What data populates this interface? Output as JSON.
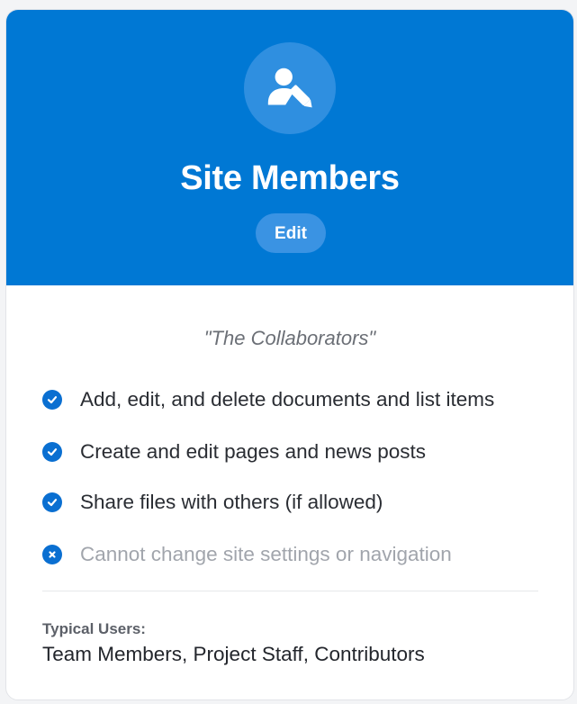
{
  "card": {
    "title": "Site Members",
    "edit_label": "Edit",
    "header_icon": "user-edit-icon",
    "tagline": "\"The Collaborators\"",
    "accent_color": "#0078d4"
  },
  "permissions": [
    {
      "label": "Add, edit, and delete documents and list items",
      "allowed": true,
      "icon": "check-circle-icon"
    },
    {
      "label": "Create and edit pages and news posts",
      "allowed": true,
      "icon": "check-circle-icon"
    },
    {
      "label": "Share files with others (if allowed)",
      "allowed": true,
      "icon": "check-circle-icon"
    },
    {
      "label": "Cannot change site settings or navigation",
      "allowed": false,
      "icon": "x-circle-icon"
    }
  ],
  "typical_users": {
    "label": "Typical Users:",
    "value": "Team Members, Project Staff, Contributors"
  }
}
